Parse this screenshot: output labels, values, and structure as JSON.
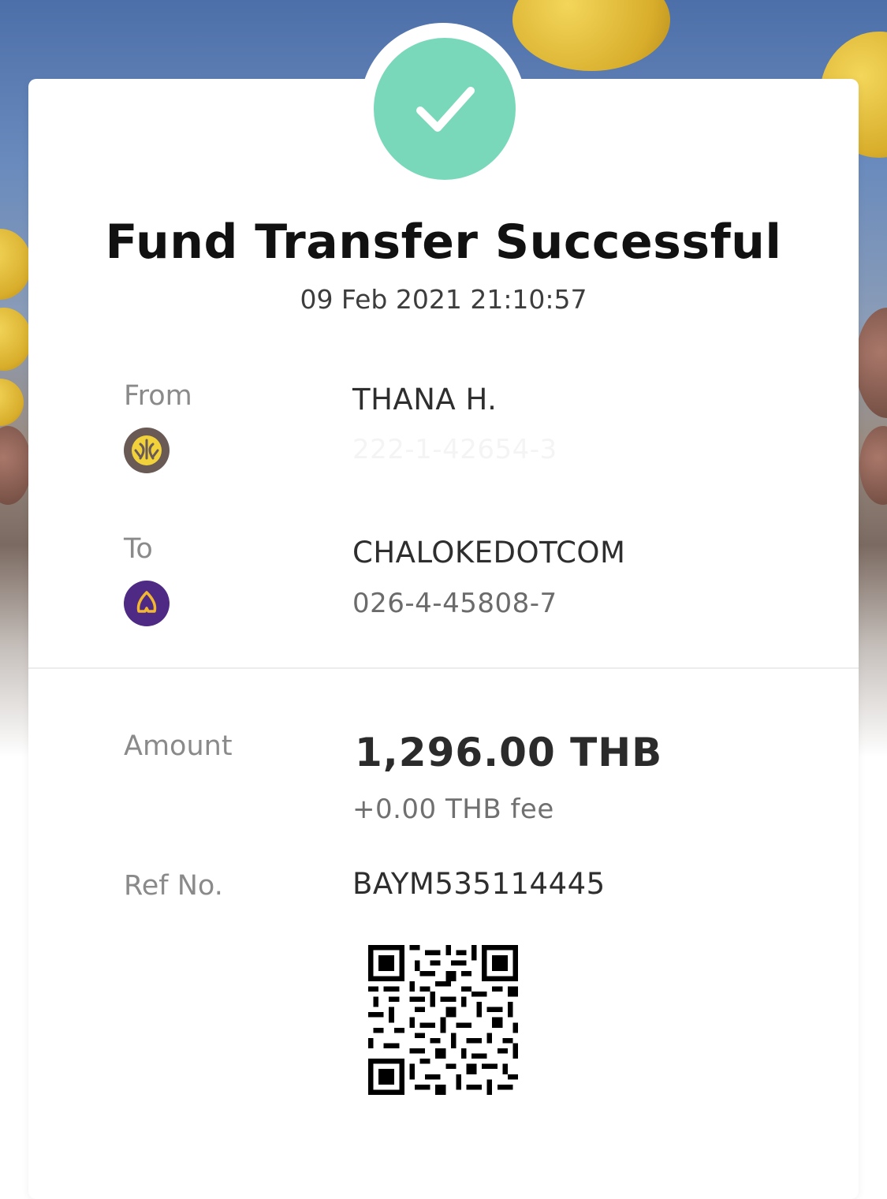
{
  "colors": {
    "success": "#79d8b9",
    "from_bank": "#6a5a55",
    "from_bank_accent": "#f2d23b",
    "to_bank": "#4e2a84",
    "to_bank_accent": "#f2b630"
  },
  "status_icon": "check-icon",
  "title": "Fund Transfer Successful",
  "datetime": "09 Feb 2021 21:10:57",
  "from": {
    "label": "From",
    "name": "THANA H.",
    "account": "222-1-42654-3",
    "bank_icon": "krungsri-bank-icon"
  },
  "to": {
    "label": "To",
    "name": "CHALOKEDOTCOM",
    "account": "026-4-45808-7",
    "bank_icon": "scb-bank-icon"
  },
  "amount": {
    "label": "Amount",
    "value": "1,296.00 THB",
    "fee": "+0.00 THB fee"
  },
  "ref": {
    "label": "Ref No.",
    "value": "BAYM535114445"
  },
  "qr_icon": "qr-code"
}
